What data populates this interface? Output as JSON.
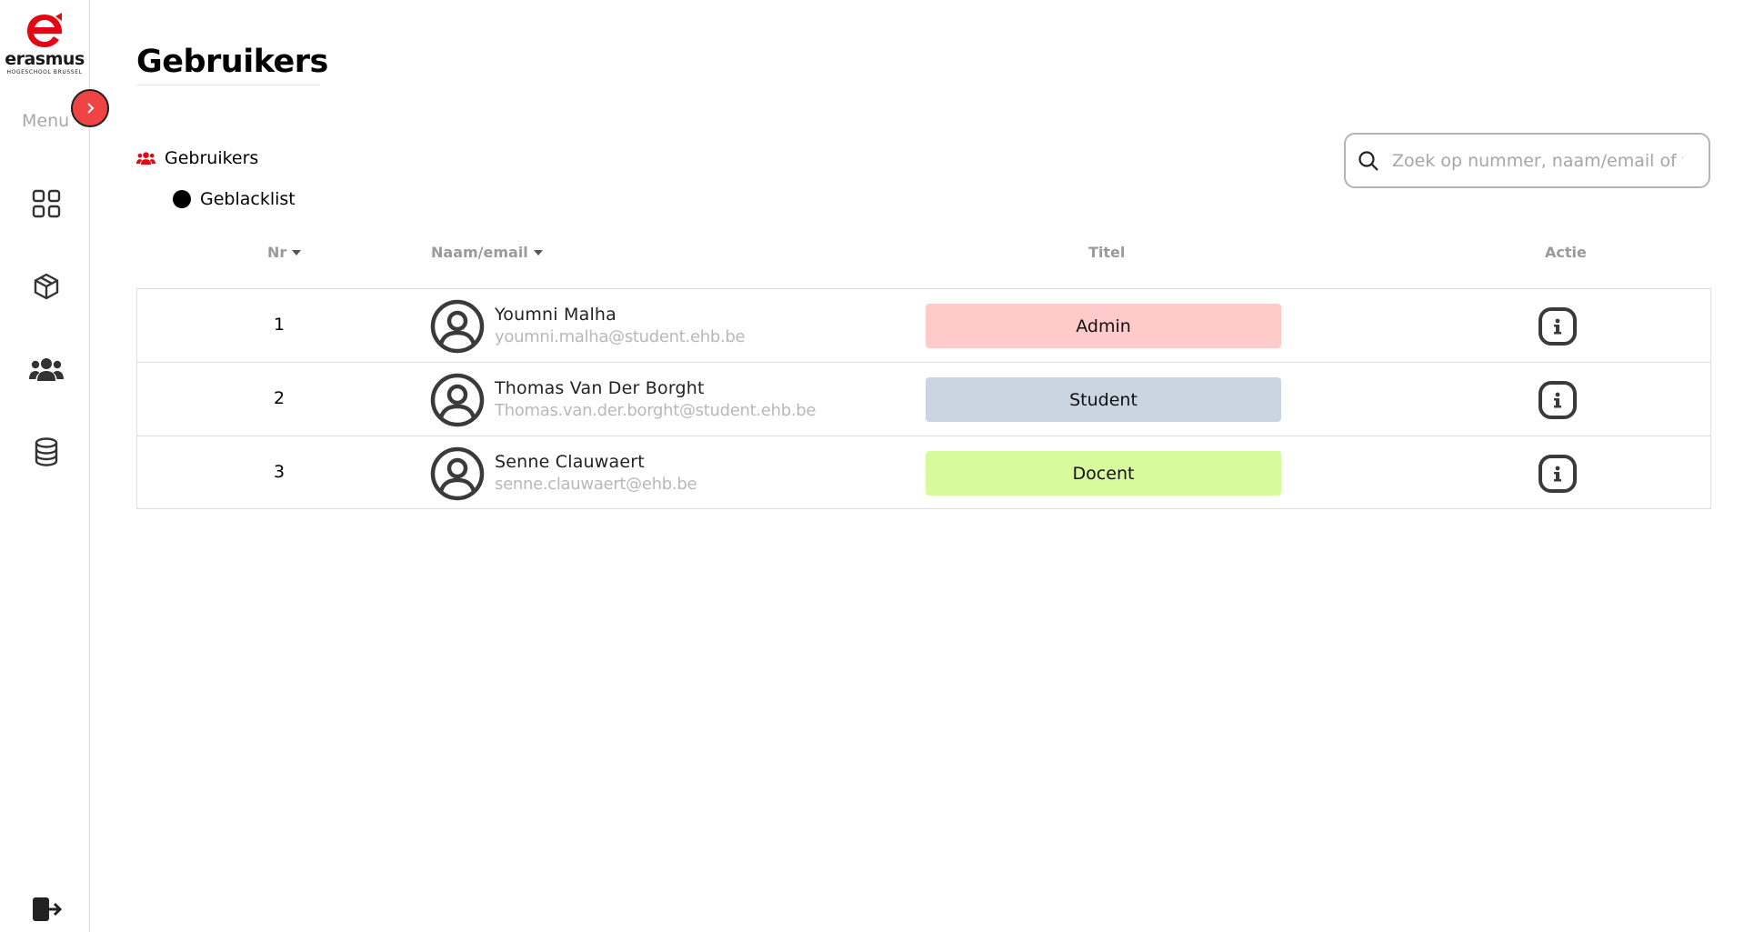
{
  "brand": {
    "name": "erasmus",
    "subtitle": "HOGESCHOOL BRUSSEL",
    "color": "#e30613"
  },
  "sidebar": {
    "menu_label": "Menu",
    "toggle_color": "#ef4444",
    "items": [
      {
        "icon": "dashboard-grid-icon"
      },
      {
        "icon": "box-icon"
      },
      {
        "icon": "users-icon"
      },
      {
        "icon": "database-icon"
      }
    ],
    "logout_icon": "logout-icon"
  },
  "page": {
    "title": "Gebruikers"
  },
  "tabs": {
    "users": "Gebruikers",
    "blacklist": "Geblacklist"
  },
  "search": {
    "placeholder": "Zoek op nummer, naam/email of titel"
  },
  "table": {
    "headers": {
      "nr": "Nr",
      "name": "Naam/email",
      "title": "Titel",
      "action": "Actie"
    },
    "rows": [
      {
        "nr": "1",
        "name": "Youmni Malha",
        "email": "youmni.malha@student.ehb.be",
        "title": "Admin",
        "badge_color": "#fecaca"
      },
      {
        "nr": "2",
        "name": "Thomas Van Der Borght",
        "email": "Thomas.van.der.borght@student.ehb.be",
        "title": "Student",
        "badge_color": "#cbd5e1"
      },
      {
        "nr": "3",
        "name": "Senne Clauwaert",
        "email": "senne.clauwaert@ehb.be",
        "title": "Docent",
        "badge_color": "#d9f99d"
      }
    ]
  }
}
